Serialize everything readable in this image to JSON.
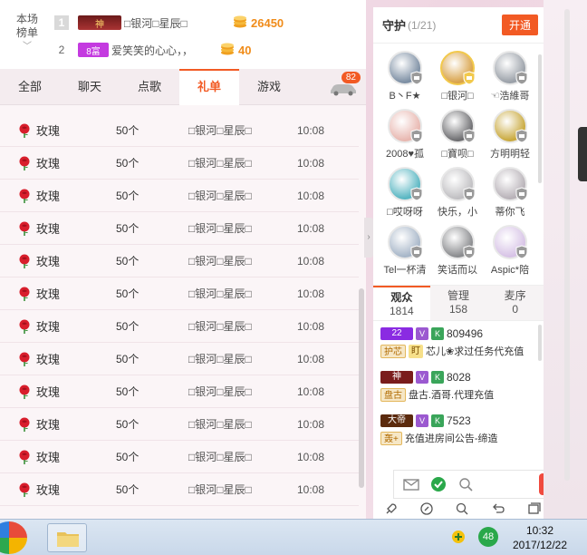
{
  "rank": {
    "label_line1": "本场",
    "label_line2": "榜单",
    "rows": [
      {
        "no": "1",
        "badge": "神",
        "name": "□银河□星辰□",
        "value": "26450"
      },
      {
        "no": "2",
        "badge": "8富",
        "name": "爱笑笑的心心，，",
        "value": "40"
      }
    ]
  },
  "tabs": [
    "全部",
    "聊天",
    "点歌",
    "礼单",
    "游戏"
  ],
  "active_tab": "礼单",
  "car_badge": "82",
  "gifts": [
    {
      "name": "玫瑰",
      "qty": "50个",
      "user": "□银河□星辰□",
      "time": "10:08"
    },
    {
      "name": "玫瑰",
      "qty": "50个",
      "user": "□银河□星辰□",
      "time": "10:08"
    },
    {
      "name": "玫瑰",
      "qty": "50个",
      "user": "□银河□星辰□",
      "time": "10:08"
    },
    {
      "name": "玫瑰",
      "qty": "50个",
      "user": "□银河□星辰□",
      "time": "10:08"
    },
    {
      "name": "玫瑰",
      "qty": "50个",
      "user": "□银河□星辰□",
      "time": "10:08"
    },
    {
      "name": "玫瑰",
      "qty": "50个",
      "user": "□银河□星辰□",
      "time": "10:08"
    },
    {
      "name": "玫瑰",
      "qty": "50个",
      "user": "□银河□星辰□",
      "time": "10:08"
    },
    {
      "name": "玫瑰",
      "qty": "50个",
      "user": "□银河□星辰□",
      "time": "10:08"
    },
    {
      "name": "玫瑰",
      "qty": "50个",
      "user": "□银河□星辰□",
      "time": "10:08"
    },
    {
      "name": "玫瑰",
      "qty": "50个",
      "user": "□银河□星辰□",
      "time": "10:08"
    },
    {
      "name": "玫瑰",
      "qty": "50个",
      "user": "□银河□星辰□",
      "time": "10:08"
    },
    {
      "name": "玫瑰",
      "qty": "50个",
      "user": "□银河□星辰□",
      "time": "10:08"
    }
  ],
  "guard": {
    "title": "守护",
    "count": "(1/21)",
    "open_label": "开通",
    "members": [
      {
        "name": "B丶F★",
        "color": "#7c8ea3"
      },
      {
        "name": "□银河□",
        "color": "#d9a34a"
      },
      {
        "name": "☜浩維哥",
        "color": "#9aa0a8"
      },
      {
        "name": "2008♥孤",
        "color": "#e8b7b0"
      },
      {
        "name": "□寶呗□",
        "color": "#6d6d70"
      },
      {
        "name": "方明明轻",
        "color": "#c9a93d"
      },
      {
        "name": "□哎呀呀",
        "color": "#58b6c2"
      },
      {
        "name": "快乐，小",
        "color": "#c0bfc2"
      },
      {
        "name": "蒂你飞",
        "color": "#b8b2b8"
      },
      {
        "name": "Tel一杯清",
        "color": "#a7b6c8"
      },
      {
        "name": "笑话而以",
        "color": "#8a8b8e"
      },
      {
        "name": "Aspic*陪",
        "color": "#d7c3e6"
      }
    ]
  },
  "audience": {
    "tabs": [
      {
        "label": "观众",
        "count": "1814"
      },
      {
        "label": "管理",
        "count": "158"
      },
      {
        "label": "麦序",
        "count": "0"
      }
    ],
    "items": [
      {
        "level": "22",
        "level_color": "#8a2be2",
        "uid": "809496",
        "tag": "护芯",
        "tag2": "盯",
        "text": "芯儿❀求过任务代充值"
      },
      {
        "level": "神",
        "level_color": "#7a1c1c",
        "uid": "8028",
        "tag": "盘古",
        "tag2": "",
        "text": "盘古.酒哥.代理充值"
      },
      {
        "level": "大帝",
        "level_color": "#5b2a0d",
        "uid": "7523",
        "tag": "轰+",
        "tag2": "",
        "text": "充值进房间公告-缔造"
      }
    ]
  },
  "colors": {
    "accent": "#f25a24",
    "coin": "#f08c1a"
  },
  "clock": {
    "time": "10:32",
    "date": "2017/12/22"
  },
  "tray_badge": "48"
}
